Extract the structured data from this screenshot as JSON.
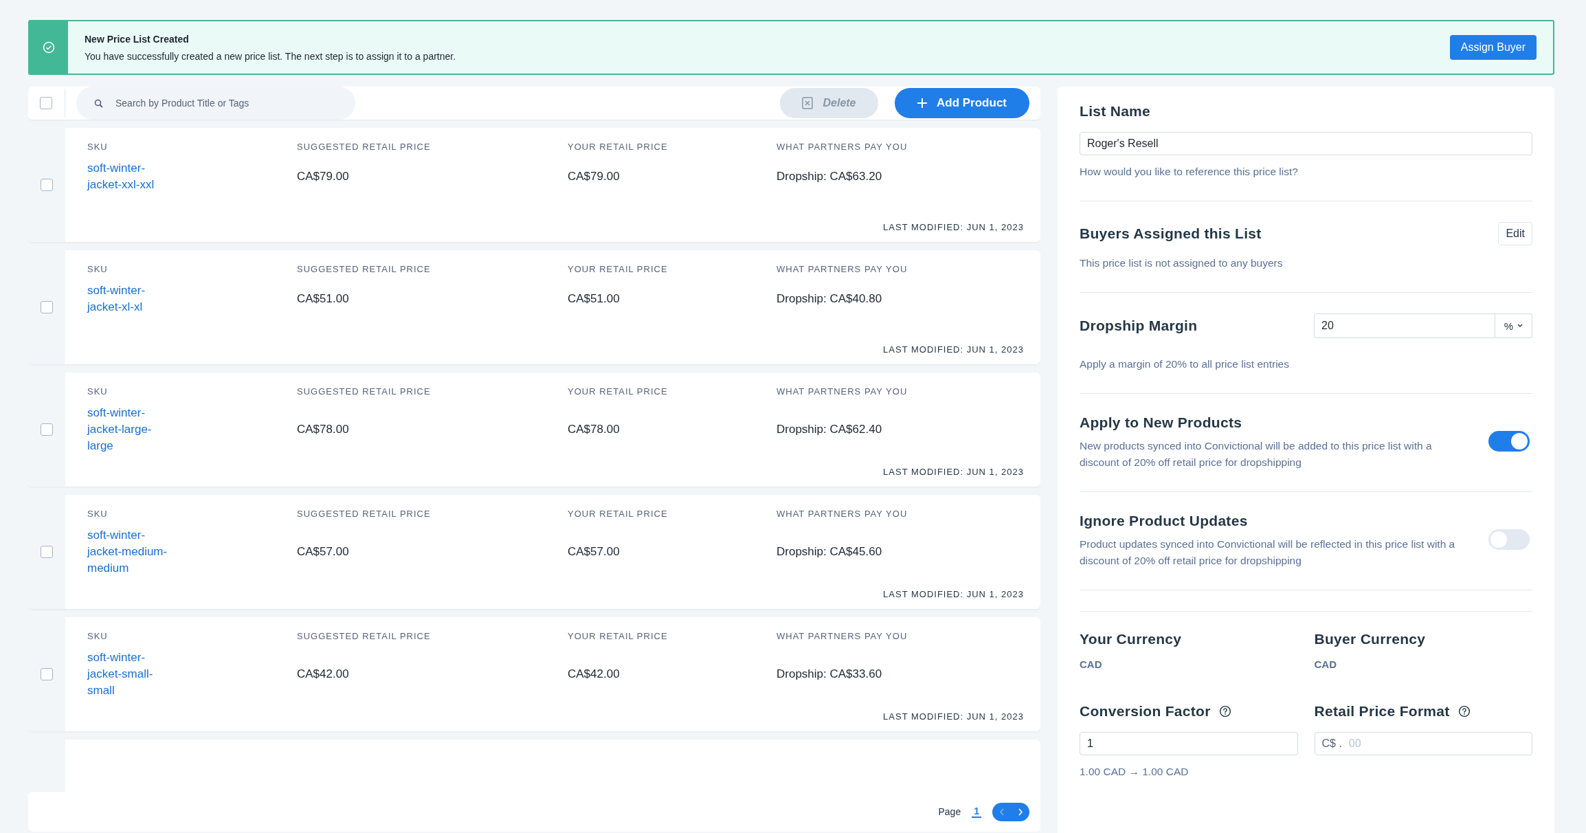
{
  "banner": {
    "title": "New Price List Created",
    "message": "You have successfully created a new price list. The next step is to assign it to a partner.",
    "button": "Assign Buyer"
  },
  "toolbar": {
    "select_all_checked": false,
    "search": {
      "placeholder": "Search by Product Title or Tags"
    },
    "delete": {
      "label": "Delete",
      "disabled": true
    },
    "add": {
      "label": "Add Product"
    }
  },
  "rows": [
    {
      "checked": false,
      "headings": [
        "SKU",
        "SUGGESTED RETAIL PRICE",
        "YOUR RETAIL PRICE",
        "WHAT PARTNERS PAY YOU"
      ],
      "sku": "soft-winter-jacket-xxl-xxl",
      "suggested": "CA$79.00",
      "yours": "CA$79.00",
      "partners": "Dropship: CA$63.20",
      "modified": "LAST MODIFIED: JUN 1, 2023"
    },
    {
      "checked": false,
      "headings": [
        "SKU",
        "SUGGESTED RETAIL PRICE",
        "YOUR RETAIL PRICE",
        "WHAT PARTNERS PAY YOU"
      ],
      "sku": "soft-winter-jacket-xl-xl",
      "suggested": "CA$51.00",
      "yours": "CA$51.00",
      "partners": "Dropship: CA$40.80",
      "modified": "LAST MODIFIED: JUN 1, 2023"
    },
    {
      "checked": false,
      "headings": [
        "SKU",
        "SUGGESTED RETAIL PRICE",
        "YOUR RETAIL PRICE",
        "WHAT PARTNERS PAY YOU"
      ],
      "sku": "soft-winter-jacket-large-large",
      "suggested": "CA$78.00",
      "yours": "CA$78.00",
      "partners": "Dropship: CA$62.40",
      "modified": "LAST MODIFIED: JUN 1, 2023"
    },
    {
      "checked": false,
      "headings": [
        "SKU",
        "SUGGESTED RETAIL PRICE",
        "YOUR RETAIL PRICE",
        "WHAT PARTNERS PAY YOU"
      ],
      "sku": "soft-winter-jacket-medium-medium",
      "suggested": "CA$57.00",
      "yours": "CA$57.00",
      "partners": "Dropship: CA$45.60",
      "modified": "LAST MODIFIED: JUN 1, 2023"
    },
    {
      "checked": false,
      "headings": [
        "SKU",
        "SUGGESTED RETAIL PRICE",
        "YOUR RETAIL PRICE",
        "WHAT PARTNERS PAY YOU"
      ],
      "sku": "soft-winter-jacket-small-small",
      "suggested": "CA$42.00",
      "yours": "CA$42.00",
      "partners": "Dropship: CA$33.60",
      "modified": "LAST MODIFIED: JUN 1, 2023"
    }
  ],
  "pagination": {
    "label": "Page",
    "current": "1"
  },
  "settings": {
    "list_name": {
      "title": "List Name",
      "value": "Roger's Resell",
      "hint": "How would you like to reference this price list?"
    },
    "buyers": {
      "title": "Buyers Assigned this List",
      "button": "Edit",
      "message": "This price list is not assigned to any buyers"
    },
    "margin": {
      "title": "Dropship Margin",
      "value": "20",
      "unit": "%",
      "hint": "Apply a margin of 20% to all price list entries"
    },
    "toggles": [
      {
        "title": "Apply to New Products",
        "description": "New products synced into Convictional will be added to this price list with a discount of 20% off retail price for dropshipping",
        "on": true
      },
      {
        "title": "Ignore Product Updates",
        "description": "Product updates synced into Convictional will be reflected in this price list with a discount of 20% off retail price for dropshipping",
        "on": false
      }
    ],
    "your_currency": {
      "title": "Your Currency",
      "value": "CAD"
    },
    "buyer_currency": {
      "title": "Buyer Currency",
      "value": "CAD"
    },
    "conversion": {
      "title": "Conversion Factor",
      "value": "1",
      "note": "1.00 CAD → 1.00 CAD"
    },
    "format": {
      "title": "Retail Price Format",
      "prefix": "C$ .",
      "placeholder": "00"
    }
  }
}
